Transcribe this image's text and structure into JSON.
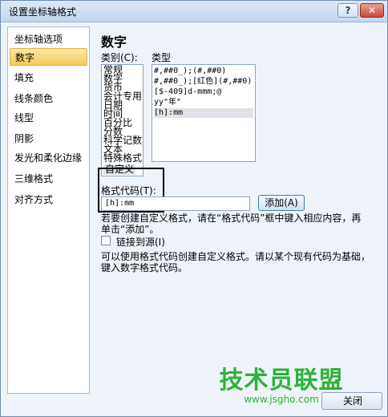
{
  "window": {
    "title": "设置坐标轴格式",
    "help_glyph": "?",
    "close_glyph": "✕"
  },
  "nav": {
    "items": [
      {
        "label": "坐标轴选项"
      },
      {
        "label": "数字",
        "selected": true
      },
      {
        "label": "填充"
      },
      {
        "label": "线条颜色"
      },
      {
        "label": "线型"
      },
      {
        "label": "阴影"
      },
      {
        "label": "发光和柔化边缘"
      },
      {
        "label": "三维格式"
      },
      {
        "label": "对齐方式"
      }
    ]
  },
  "panel": {
    "title": "数字",
    "category_label": "类别(C):",
    "type_label": "类型",
    "categories": [
      "常规",
      "数字",
      "货币",
      "会计专用",
      "日期",
      "时间",
      "百分比",
      "分数",
      "科学记数",
      "文本",
      "特殊格式",
      "自定义"
    ],
    "selected_category": "自定义",
    "types": [
      "#,##0_);(#,##0)",
      "#,##0_);[红色](#,##0)",
      "[$-409]d-mmm;@",
      "yy\"年\"",
      "[h]:mm"
    ],
    "selected_type": "[h]:mm",
    "format_code_label": "格式代码(T):",
    "format_code_value": "[h]:mm",
    "add_button_label": "添加(A)",
    "hint_line1": "若要创建自定义格式，请在“格式代码”框中键入相应内容，再",
    "hint_line2": "单击“添加”。",
    "link_source_label": "链接到源(I)",
    "desc_line1": "可以使用格式代码创建自定义格式。请以某个现有代码为基础，",
    "desc_line2": "键入数字格式代码。"
  },
  "watermark": {
    "text": "技术员联盟",
    "url": "www.jsgho.com"
  },
  "footer": {
    "close_label": "关闭"
  }
}
